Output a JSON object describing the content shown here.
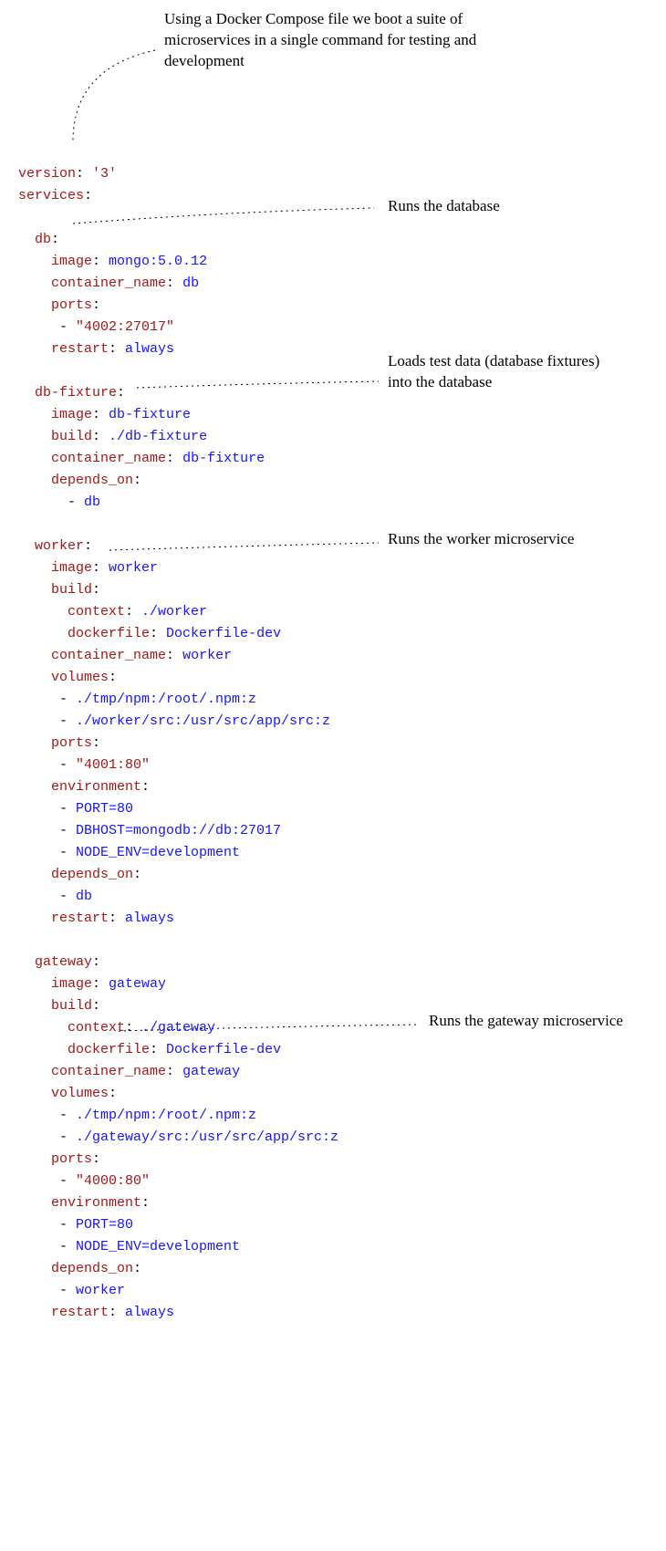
{
  "annotations": {
    "top": "Using a Docker Compose file we boot a suite of microservices in a single command for testing and development",
    "db": "Runs the database",
    "fixture": "Loads test data (database fixtures) into the database",
    "worker": "Runs the worker microservice",
    "gateway": "Runs the gateway microservice"
  },
  "code": {
    "version_key": "version",
    "version_val": "'3'",
    "services": "services",
    "db": {
      "name": "db",
      "image_k": "image",
      "image_v": "mongo:5.0.12",
      "cname_k": "container_name",
      "cname_v": "db",
      "ports_k": "ports",
      "port_v": "\"4002:27017\"",
      "restart_k": "restart",
      "restart_v": "always"
    },
    "fixture": {
      "name": "db-fixture",
      "image_k": "image",
      "image_v": "db-fixture",
      "build_k": "build",
      "build_v": "./db-fixture",
      "cname_k": "container_name",
      "cname_v": "db-fixture",
      "dep_k": "depends_on",
      "dep_v": "db"
    },
    "worker": {
      "name": "worker",
      "image_k": "image",
      "image_v": "worker",
      "build_k": "build",
      "ctx_k": "context",
      "ctx_v": "./worker",
      "df_k": "dockerfile",
      "df_v": "Dockerfile-dev",
      "cname_k": "container_name",
      "cname_v": "worker",
      "vol_k": "volumes",
      "vol1": "./tmp/npm:/root/.npm:z",
      "vol2": "./worker/src:/usr/src/app/src:z",
      "ports_k": "ports",
      "port_v": "\"4001:80\"",
      "env_k": "environment",
      "env1": "PORT=80",
      "env2": "DBHOST=mongodb://db:27017",
      "env3": "NODE_ENV=development",
      "dep_k": "depends_on",
      "dep_v": "db",
      "restart_k": "restart",
      "restart_v": "always"
    },
    "gateway": {
      "name": "gateway",
      "image_k": "image",
      "image_v": "gateway",
      "build_k": "build",
      "ctx_k": "context",
      "ctx_v": "./gateway",
      "df_k": "dockerfile",
      "df_v": "Dockerfile-dev",
      "cname_k": "container_name",
      "cname_v": "gateway",
      "vol_k": "volumes",
      "vol1": "./tmp/npm:/root/.npm:z",
      "vol2": "./gateway/src:/usr/src/app/src:z",
      "ports_k": "ports",
      "port_v": "\"4000:80\"",
      "env_k": "environment",
      "env1": "PORT=80",
      "env2": "NODE_ENV=development",
      "dep_k": "depends_on",
      "dep_v": "worker",
      "restart_k": "restart",
      "restart_v": "always"
    }
  }
}
